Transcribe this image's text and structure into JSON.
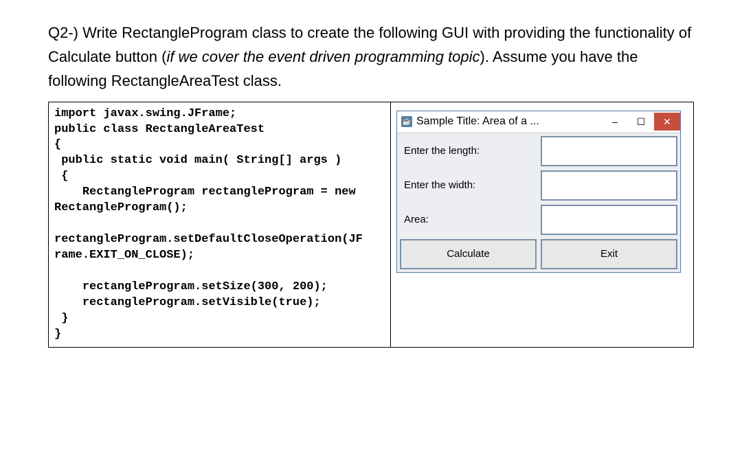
{
  "question": {
    "prefix": "Q2-) Write RectangleProgram class to create the following GUI with providing the functionality of Calculate button (",
    "italic": "if we cover the event driven programming topic",
    "suffix": "). Assume you have the following RectangleAreaTest class."
  },
  "code": "import javax.swing.JFrame;\npublic class RectangleAreaTest\n{\n public static void main( String[] args )\n {\n    RectangleProgram rectangleProgram = new\nRectangleProgram();\n\nrectangleProgram.setDefaultCloseOperation(JF\nrame.EXIT_ON_CLOSE);\n\n    rectangleProgram.setSize(300, 200);\n    rectangleProgram.setVisible(true);\n }\n}",
  "window": {
    "icon_glyph": "☕",
    "title": "Sample Title: Area of a ...",
    "minimize": "–",
    "maximize": "☐",
    "close": "✕",
    "labels": {
      "length": "Enter the length:",
      "width": "Enter the width:",
      "area": "Area:"
    },
    "inputs": {
      "length": "",
      "width": "",
      "area": ""
    },
    "buttons": {
      "calculate": "Calculate",
      "exit": "Exit"
    }
  }
}
